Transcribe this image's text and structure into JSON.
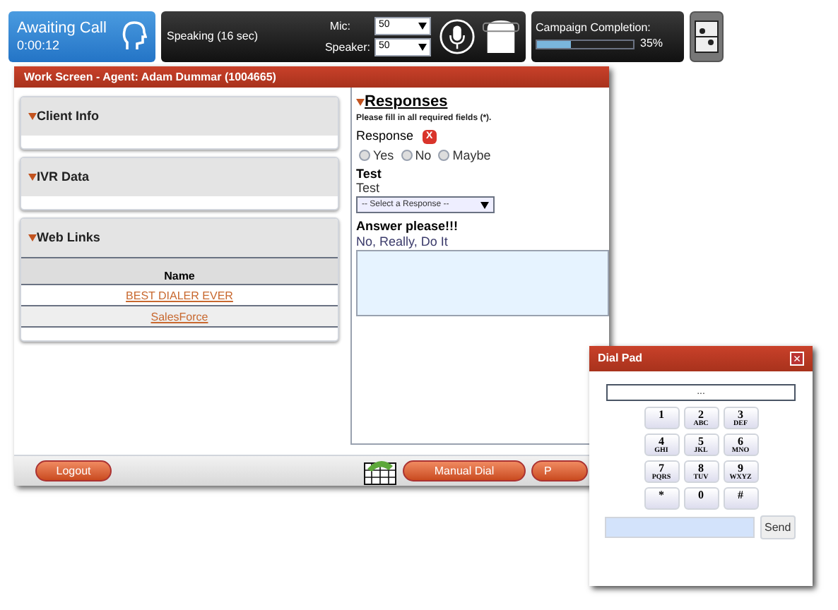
{
  "status": {
    "title": "Awaiting Call",
    "timer": "0:00:12"
  },
  "call": {
    "text": "Speaking (16 sec)",
    "mic_label": "Mic:",
    "mic_value": "50",
    "speaker_label": "Speaker:",
    "speaker_value": "50"
  },
  "campaign": {
    "label": "Campaign Completion:",
    "level": 0.35,
    "reading": "35%"
  },
  "work_screen": {
    "title": "Work Screen - Agent: Adam Dummar (1004665)",
    "panels": [
      {
        "title": "Client Info",
        "kind": "empty"
      },
      {
        "title": "IVR Data",
        "kind": "empty"
      },
      {
        "title": "Web Links",
        "kind": "table",
        "column": "Name",
        "links": [
          "BEST DIALER EVER",
          "SalesForce"
        ]
      }
    ],
    "responses": {
      "title": "Responses",
      "note": "Please fill in all required fields (*).",
      "questions": [
        {
          "kind": "radio",
          "label": "Response",
          "error": "X",
          "options": [
            {
              "label": "Yes",
              "selected": false
            },
            {
              "label": "No",
              "selected": false
            },
            {
              "label": "Maybe",
              "selected": false
            }
          ]
        },
        {
          "kind": "select",
          "label": "Test",
          "description": "Test",
          "value": "-- Select a Response --"
        },
        {
          "kind": "textarea",
          "label": "Answer please!!!",
          "description": "No, Really, Do It"
        }
      ]
    },
    "buttons": [
      "Logout",
      "Manual Dial",
      "P"
    ]
  },
  "dial_pad": {
    "title": "Dial Pad",
    "close": "×",
    "display": "...",
    "keys": [
      {
        "digit": "1"
      },
      {
        "digit": "2",
        "letters": "ABC"
      },
      {
        "digit": "3",
        "letters": "DEF"
      },
      {
        "digit": "4",
        "letters": "GHI"
      },
      {
        "digit": "5",
        "letters": "JKL"
      },
      {
        "digit": "6",
        "letters": "MNO"
      },
      {
        "digit": "7",
        "letters": "PQRS"
      },
      {
        "digit": "8",
        "letters": "TUV"
      },
      {
        "digit": "9",
        "letters": "WXYZ"
      },
      {
        "digit": "*"
      },
      {
        "digit": "0"
      },
      {
        "digit": "#"
      }
    ],
    "send": "Send"
  }
}
